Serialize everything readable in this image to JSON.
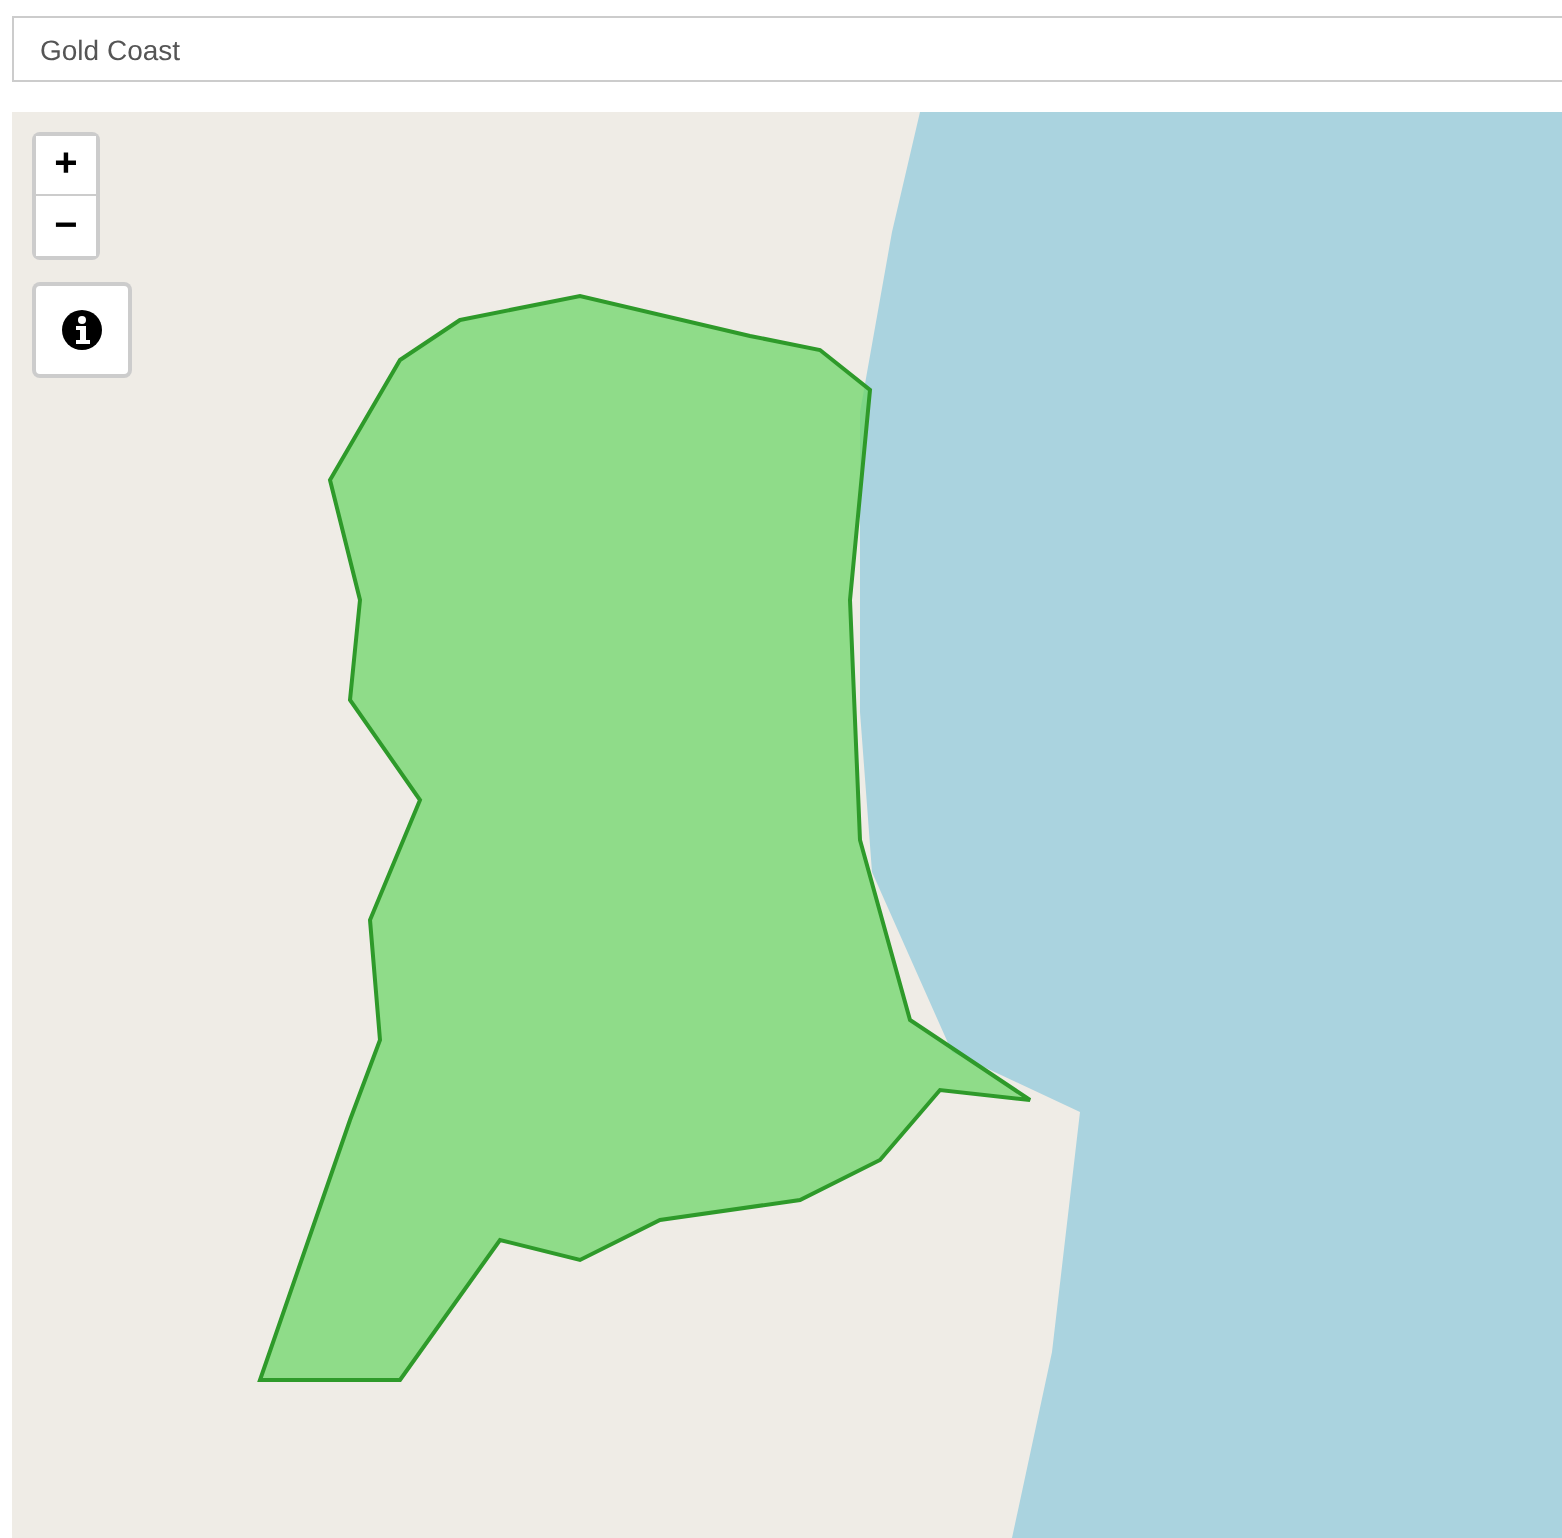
{
  "search": {
    "value": "Gold Coast"
  },
  "map": {
    "zoom_in": "+",
    "zoom_out": "−"
  }
}
